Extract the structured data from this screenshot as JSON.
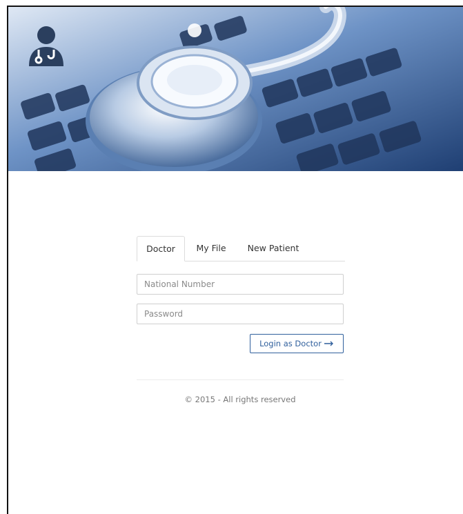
{
  "header": {
    "logo_icon": "doctor-stethoscope-icon",
    "banner_image": "stethoscope-on-laptop-keyboard"
  },
  "login": {
    "tabs": [
      {
        "label": "Doctor",
        "active": true
      },
      {
        "label": "My File",
        "active": false
      },
      {
        "label": "New Patient",
        "active": false
      }
    ],
    "national_number_placeholder": "National Number",
    "password_placeholder": "Password",
    "submit_label": "Login as Doctor",
    "submit_icon": "arrow-right-icon"
  },
  "footer": {
    "copyright": "© 2015 - All rights reserved"
  },
  "colors": {
    "accent": "#2f5f9c",
    "banner_tint": "#3f6fb0"
  }
}
